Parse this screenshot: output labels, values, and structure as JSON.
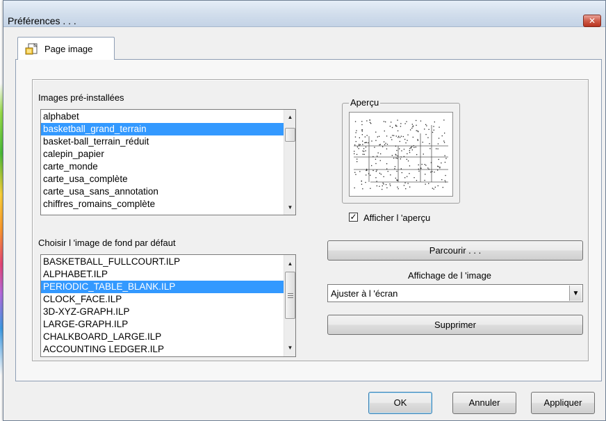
{
  "window": {
    "title": "Préférences . . .",
    "close_glyph": "✕"
  },
  "tab": {
    "label": "Page image",
    "icon": "image-file-icon"
  },
  "preinstalled": {
    "label": "Images pré-installées",
    "items": [
      "alphabet",
      "basketball_grand_terrain",
      "basket-ball_terrain_réduit",
      "calepin_papier",
      "carte_monde",
      "carte_usa_complète",
      "carte_usa_sans_annotation",
      "chiffres_romains_complète"
    ],
    "selected_index": 1
  },
  "default_bg": {
    "label": "Choisir l 'image de fond par défaut",
    "items": [
      "BASKETBALL_FULLCOURT.ILP",
      "ALPHABET.ILP",
      "PERIODIC_TABLE_BLANK.ILP",
      "CLOCK_FACE.ILP",
      "3D-XYZ-GRAPH.ILP",
      "LARGE-GRAPH.ILP",
      "CHALKBOARD_LARGE.ILP",
      "ACCOUNTING LEDGER.ILP"
    ],
    "selected_index": 2
  },
  "preview": {
    "legend": "Aperçu",
    "show_label": "Afficher l 'aperçu",
    "show_checked": true,
    "check_glyph": "✓"
  },
  "browse_button": "Parcourir . . .",
  "display": {
    "label": "Affichage de l 'image",
    "selected": "Ajuster à l 'écran"
  },
  "delete_button": "Supprimer",
  "footer": {
    "ok": "OK",
    "cancel": "Annuler",
    "apply": "Appliquer"
  },
  "colors": {
    "selection": "#3399ff",
    "dialog_bg": "#f0f0f0"
  }
}
